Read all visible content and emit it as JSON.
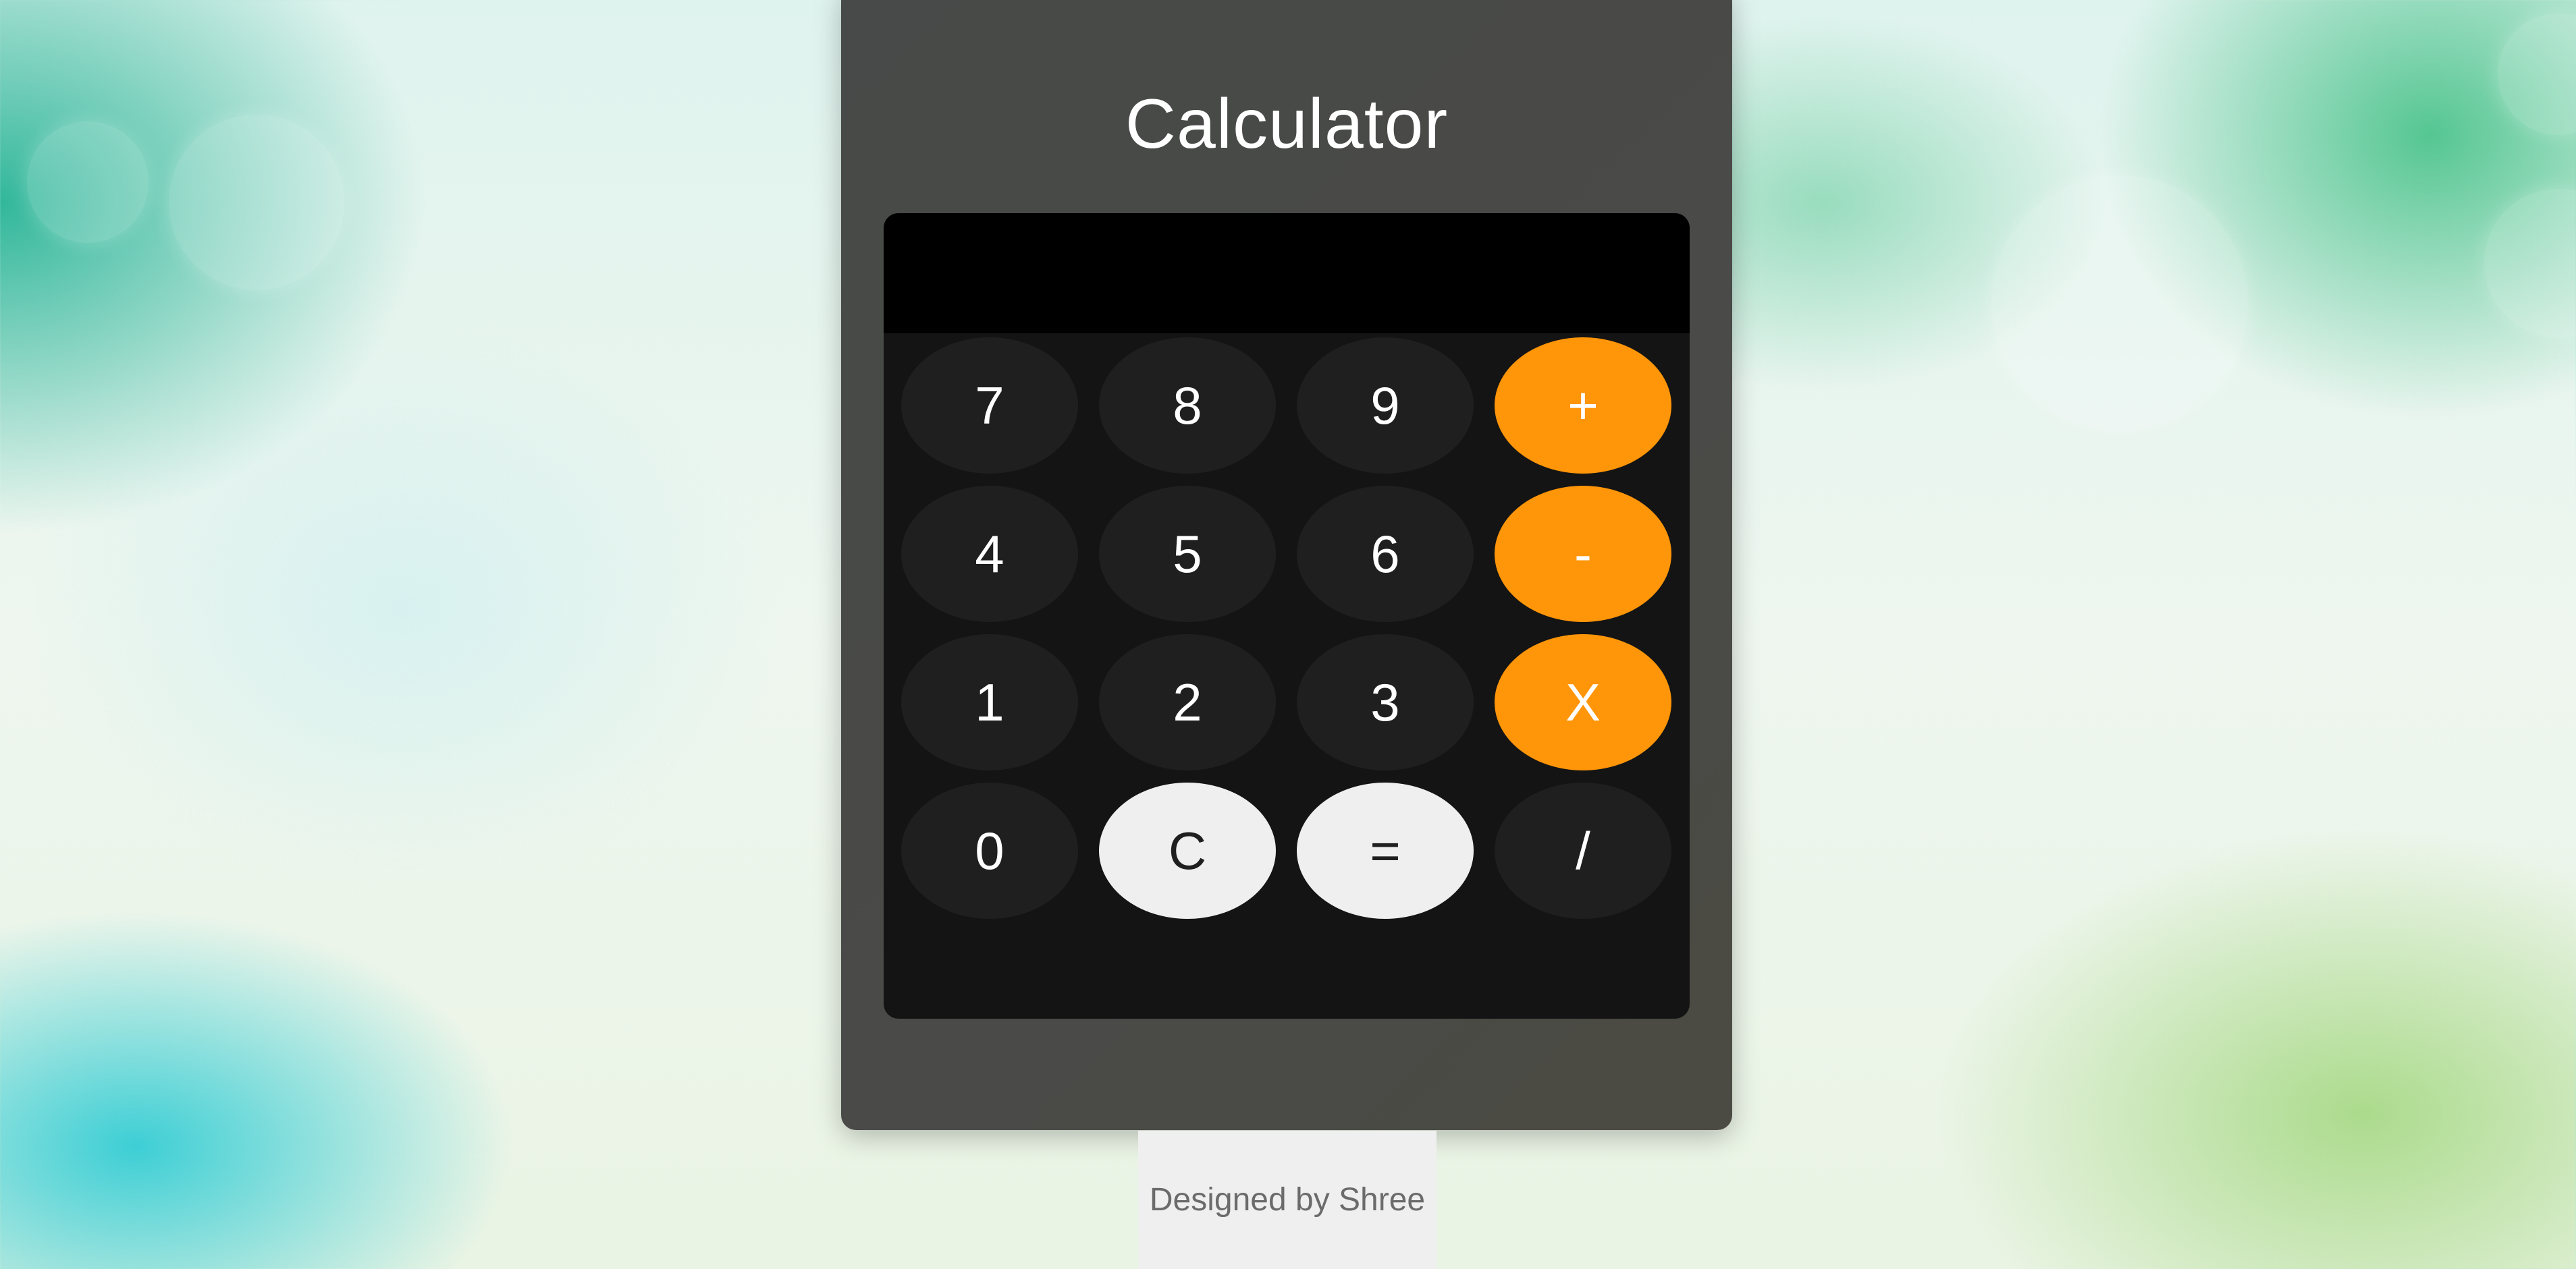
{
  "app": {
    "title": "Calculator"
  },
  "display": {
    "value": ""
  },
  "keypad": {
    "rows": [
      [
        {
          "label": "7",
          "name": "key-7",
          "style": "digit"
        },
        {
          "label": "8",
          "name": "key-8",
          "style": "digit"
        },
        {
          "label": "9",
          "name": "key-9",
          "style": "digit"
        },
        {
          "label": "+",
          "name": "key-plus",
          "style": "operator"
        }
      ],
      [
        {
          "label": "4",
          "name": "key-4",
          "style": "digit"
        },
        {
          "label": "5",
          "name": "key-5",
          "style": "digit"
        },
        {
          "label": "6",
          "name": "key-6",
          "style": "digit"
        },
        {
          "label": "-",
          "name": "key-minus",
          "style": "operator"
        }
      ],
      [
        {
          "label": "1",
          "name": "key-1",
          "style": "digit"
        },
        {
          "label": "2",
          "name": "key-2",
          "style": "digit"
        },
        {
          "label": "3",
          "name": "key-3",
          "style": "digit"
        },
        {
          "label": "X",
          "name": "key-multiply",
          "style": "operator"
        }
      ],
      [
        {
          "label": "0",
          "name": "key-0",
          "style": "digit"
        },
        {
          "label": "C",
          "name": "key-clear",
          "style": "light"
        },
        {
          "label": "=",
          "name": "key-equals",
          "style": "light"
        },
        {
          "label": "/",
          "name": "key-divide",
          "style": "digit"
        }
      ]
    ]
  },
  "footer": {
    "credit": "Designed by Shree"
  },
  "colors": {
    "operator": "#ff9508",
    "digit": "#1f1f1f",
    "light": "#efefef",
    "panel": "#474a48",
    "screen": "#141414",
    "display": "#000000"
  }
}
